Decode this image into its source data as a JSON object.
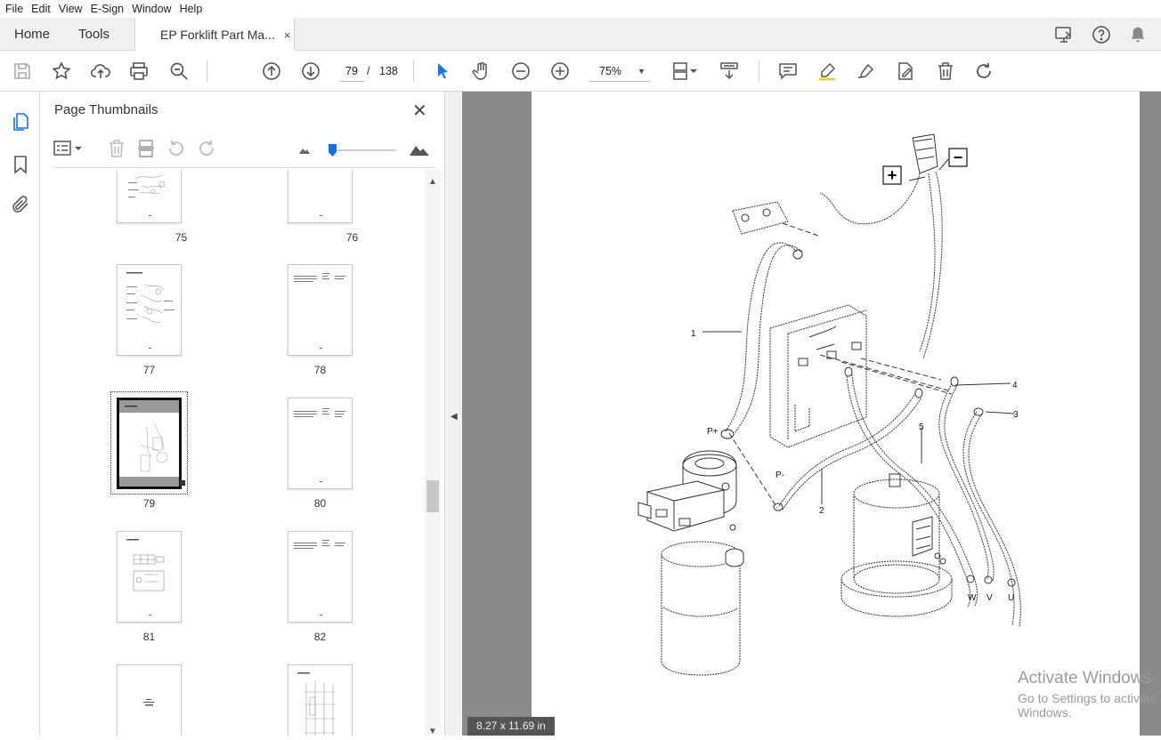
{
  "menu": [
    "File",
    "Edit",
    "View",
    "E-Sign",
    "Window",
    "Help"
  ],
  "tabs": {
    "home": "Home",
    "tools": "Tools",
    "document": "EP Forklift Part Ma...",
    "close_glyph": "×"
  },
  "toolbar": {
    "current_page": "79",
    "page_separator": "/",
    "total_pages": "138",
    "zoom": "75%"
  },
  "panel": {
    "title": "Page Thumbnails",
    "close_glyph": "✕"
  },
  "thumbnails": [
    {
      "label": "75"
    },
    {
      "label": "76"
    },
    {
      "label": "77"
    },
    {
      "label": "78"
    },
    {
      "label": "79",
      "selected": true
    },
    {
      "label": "80"
    },
    {
      "label": "81"
    },
    {
      "label": "82"
    },
    {
      "label": ""
    },
    {
      "label": ""
    }
  ],
  "drawing": {
    "callouts": [
      "1",
      "4",
      "3",
      "5",
      "2"
    ],
    "terminals": [
      "P+",
      "P-",
      "W",
      "V",
      "U"
    ],
    "plus": "+",
    "minus": "−"
  },
  "status": {
    "page_size": "8.27 x 11.69 in"
  },
  "watermark": {
    "line1": "Activate Windows",
    "line2": "Go to Settings to activate Windows."
  },
  "colors": {
    "accent": "#1473e6",
    "doc_background": "#8a8a8a"
  }
}
